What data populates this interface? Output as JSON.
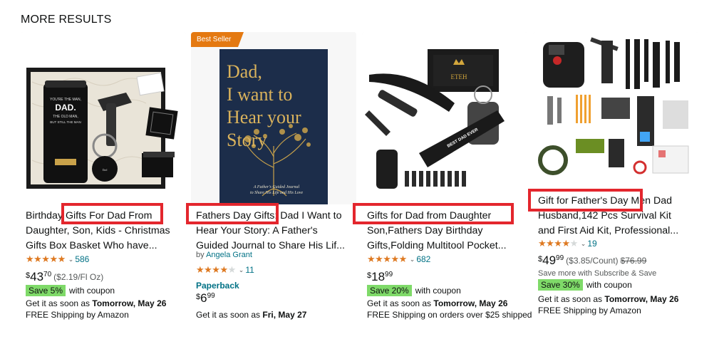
{
  "section_title": "MORE RESULTS",
  "products": [
    {
      "badge": "",
      "title_lines": [
        "Birthday Gifts For Dad From",
        "Daughter, Son, Kids - Christmas",
        "Gifts Box Basket Who have..."
      ],
      "rating": 5,
      "rating_count": "586",
      "price_symbol": "$",
      "price_whole": "43",
      "price_fraction": "70",
      "unit_price": "($2.19/Fl Oz)",
      "coupon_tag": "Save 5%",
      "coupon_text": "with coupon",
      "delivery_prefix": "Get it as soon as ",
      "delivery_date": "Tomorrow, May 26",
      "shipping": "FREE Shipping by Amazon"
    },
    {
      "badge": "Best Seller",
      "title_lines": [
        "Fathers Day Gifts: Dad I Want to",
        "Hear Your Story: A Father's",
        "Guided Journal to Share His Lif..."
      ],
      "author_prefix": "by ",
      "author": "Angela Grant",
      "rating": 4,
      "rating_count": "11",
      "format": "Paperback",
      "price_symbol": "$",
      "price_whole": "6",
      "price_fraction": "99",
      "delivery_prefix": "Get it as soon as ",
      "delivery_date": "Fri, May 27",
      "book_cover": {
        "title_lines": [
          "Dad,",
          "I want to",
          "Hear your",
          "Story"
        ],
        "subtitle_lines": [
          "A Father's Guided Journal",
          "to Share His Life and His Love"
        ]
      }
    },
    {
      "badge": "",
      "title_lines": [
        "Gifts for Dad from Daughter",
        "Son,Fathers Day Birthday",
        "Gifts,Folding Multitool Pocket..."
      ],
      "rating": 5,
      "rating_count": "682",
      "price_symbol": "$",
      "price_whole": "18",
      "price_fraction": "99",
      "coupon_tag": "Save 20%",
      "coupon_text": "with coupon",
      "delivery_prefix": "Get it as soon as ",
      "delivery_date": "Tomorrow, May 26",
      "shipping": "FREE Shipping on orders over $25 shipped"
    },
    {
      "badge": "",
      "title_lines": [
        "Gift for Father's Day Men Dad",
        "Husband,142 Pcs Survival Kit",
        "and First Aid Kit, Professional..."
      ],
      "rating": 4,
      "rating_count": "19",
      "price_symbol": "$",
      "price_whole": "49",
      "price_fraction": "99",
      "unit_price": "($3.85/Count)",
      "list_price": "$76.99",
      "subscribe_text": "Save more with Subscribe & Save",
      "coupon_tag": "Save 30%",
      "coupon_text": "with coupon",
      "delivery_prefix": "Get it as soon as ",
      "delivery_date": "Tomorrow, May 26",
      "shipping": "FREE Shipping by Amazon"
    }
  ],
  "colors": {
    "highlight": "#e3262d",
    "star": "#de7921",
    "link": "#007185",
    "coupon": "#7fda69",
    "badge": "#e47911"
  }
}
